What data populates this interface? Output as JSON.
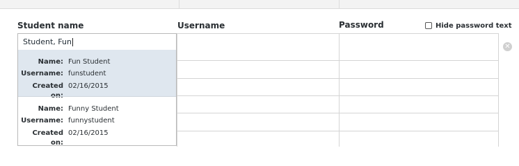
{
  "columns": {
    "student_name": "Student name",
    "username": "Username",
    "password": "Password"
  },
  "hide_password": {
    "label": "Hide password text",
    "checked": false
  },
  "search": {
    "value": "Student, Fun"
  },
  "suggestions": [
    {
      "name_label": "Name:",
      "name": "Fun Student",
      "username_label": "Username:",
      "username": "funstudent",
      "created_label": "Created on:",
      "created": "02/16/2015",
      "selected": true
    },
    {
      "name_label": "Name:",
      "name": "Funny Student",
      "username_label": "Username:",
      "username": "funnystudent",
      "created_label": "Created on:",
      "created": "02/16/2015",
      "selected": false
    }
  ],
  "remove_icon": "close-circle-icon",
  "colors": {
    "selected_row": "#dfe7ef",
    "border": "#d4d4d4",
    "remove_icon": "#d0d0d0"
  }
}
